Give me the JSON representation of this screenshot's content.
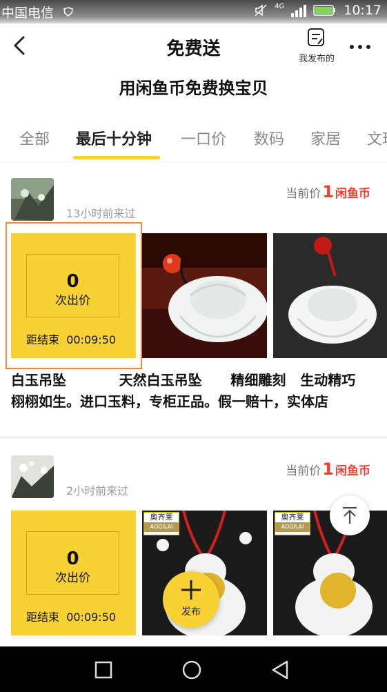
{
  "status_bar": {
    "carrier": "中国电信",
    "network": "4G",
    "time": "10:17"
  },
  "header": {
    "title": "免费送",
    "my_published": "我发布的",
    "back_icon": "chevron-left-icon",
    "more_icon": "more-icon"
  },
  "subtitle": "用闲鱼币免费换宝贝",
  "tabs": [
    {
      "label": "全部",
      "active": false
    },
    {
      "label": "最后十分钟",
      "active": true
    },
    {
      "label": "一口价",
      "active": false
    },
    {
      "label": "数码",
      "active": false
    },
    {
      "label": "家居",
      "active": false
    },
    {
      "label": "文玩",
      "active": false
    }
  ],
  "items": [
    {
      "visited": "13小时前来过",
      "price_prefix": "当前价",
      "price_value": "1",
      "price_unit": "闲鱼币",
      "bid_count": "0",
      "bid_label": "次出价",
      "ends_label": "距结束",
      "countdown": "00:09:50",
      "desc_line1": "白玉吊坠           天然白玉吊坠      精细雕刻   生动精巧",
      "desc_line2": "栩栩如生。进口玉料，专柜正品。假一赔十，实体店"
    },
    {
      "visited": "2小时前来过",
      "price_prefix": "当前价",
      "price_value": "1",
      "price_unit": "闲鱼币",
      "bid_count": "0",
      "bid_label": "次出价",
      "ends_label": "距结束",
      "countdown": "00:09:50",
      "brand_cn": "奥齐莱",
      "brand_en": "AOQILAI"
    }
  ],
  "fab": {
    "publish_label": "发布"
  },
  "colors": {
    "accent": "#f8d235",
    "price": "#ff3b30",
    "highlight": "#ee8a3d"
  }
}
